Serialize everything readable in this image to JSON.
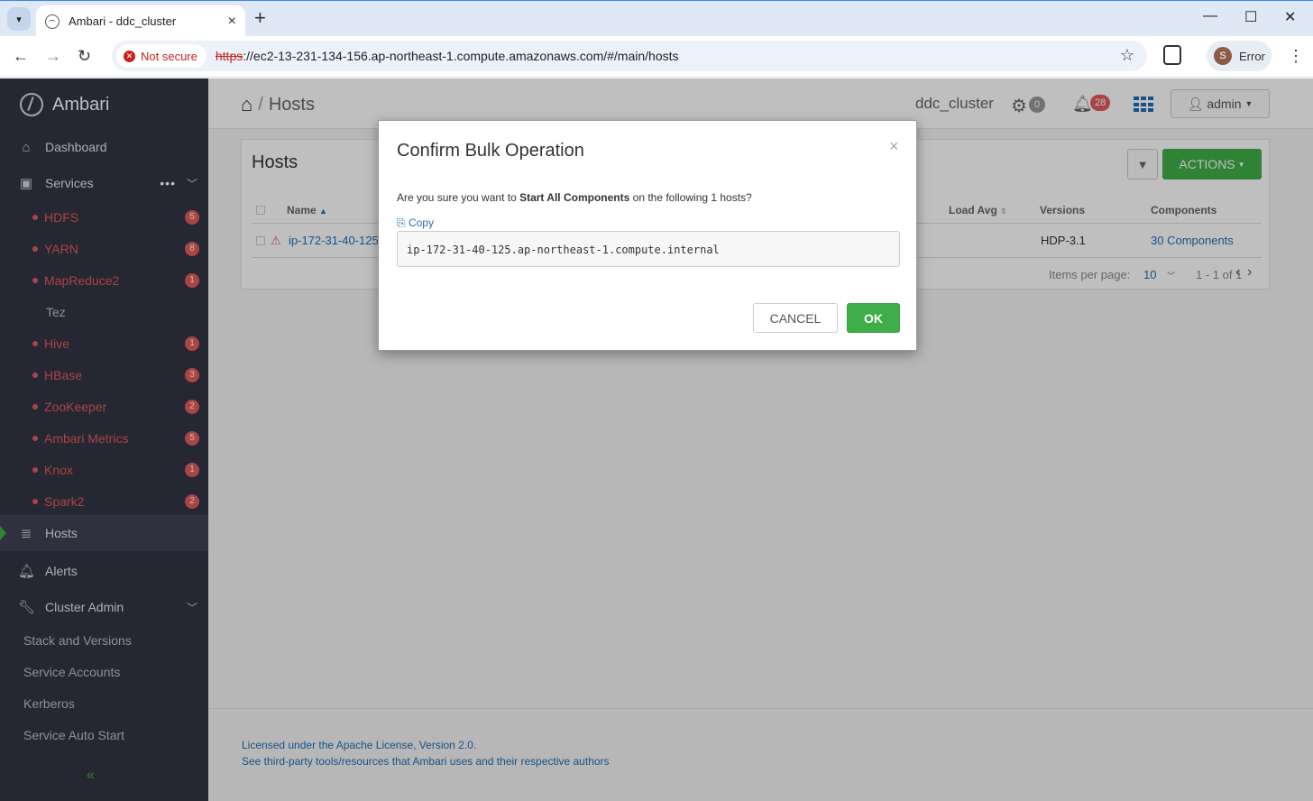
{
  "browser": {
    "tab_title": "Ambari - ddc_cluster",
    "security_chip": "Not secure",
    "url_scheme": "https",
    "url_rest": "://ec2-13-231-134-156.ap-northeast-1.compute.amazonaws.com/#/main/hosts",
    "profile_initial": "S",
    "profile_status": "Error"
  },
  "sidebar": {
    "brand": "Ambari",
    "dashboard": "Dashboard",
    "services": "Services",
    "service_items": [
      {
        "name": "HDFS",
        "alerts": "5"
      },
      {
        "name": "YARN",
        "alerts": "8"
      },
      {
        "name": "MapReduce2",
        "alerts": "1"
      },
      {
        "name": "Tez",
        "alerts": ""
      },
      {
        "name": "Hive",
        "alerts": "1"
      },
      {
        "name": "HBase",
        "alerts": "3"
      },
      {
        "name": "ZooKeeper",
        "alerts": "2"
      },
      {
        "name": "Ambari Metrics",
        "alerts": "5"
      },
      {
        "name": "Knox",
        "alerts": "1"
      },
      {
        "name": "Spark2",
        "alerts": "2"
      }
    ],
    "hosts": "Hosts",
    "alerts": "Alerts",
    "cluster_admin": "Cluster Admin",
    "cluster_admin_items": [
      "Stack and Versions",
      "Service Accounts",
      "Kerberos",
      "Service Auto Start"
    ]
  },
  "topnav": {
    "breadcrumb": "Hosts",
    "cluster_name": "ddc_cluster",
    "ops_count": "0",
    "alerts_count": "28",
    "user": "admin"
  },
  "hosts_panel": {
    "title": "Hosts",
    "actions_label": "ACTIONS",
    "columns": {
      "name": "Name",
      "load_avg": "Load Avg",
      "versions": "Versions",
      "components": "Components"
    },
    "row": {
      "name": "ip-172-31-40-125",
      "version": "HDP-3.1",
      "components": "30 Components"
    },
    "pager": {
      "items_per_page_label": "Items per page:",
      "items_per_page": "10",
      "range": "1 - 1 of 1"
    }
  },
  "footer": {
    "license": "Licensed under the Apache License, Version 2.0.",
    "thirdparty": "See third-party tools/resources that Ambari uses and their respective authors"
  },
  "modal": {
    "title": "Confirm Bulk Operation",
    "msg_prefix": "Are you sure you want to ",
    "msg_action": "Start All Components",
    "msg_suffix": " on the following 1 hosts?",
    "copy_label": "Copy",
    "host": "ip-172-31-40-125.ap-northeast-1.compute.internal",
    "cancel_label": "CANCEL",
    "ok_label": "OK"
  },
  "colors": {
    "accent_green": "#3fae49",
    "alert_red": "#e35c5c",
    "link_blue": "#1e6fb5",
    "sidebar_bg": "#323544"
  }
}
